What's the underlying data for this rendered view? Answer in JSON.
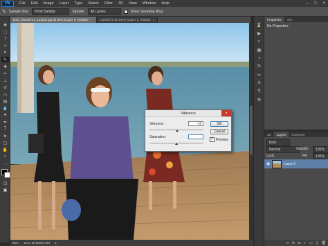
{
  "app": {
    "logo": "Ps"
  },
  "menu": [
    "File",
    "Edit",
    "Image",
    "Layer",
    "Type",
    "Select",
    "Filter",
    "3D",
    "View",
    "Window",
    "Help"
  ],
  "window_controls": [
    "–",
    "□",
    "×"
  ],
  "options_bar": {
    "sample_size_label": "Sample Size:",
    "sample_size_value": "Point Sample",
    "sample_label": "Sample:",
    "sample_value": "All Layers",
    "show_ring_label": "Show Sampling Ring"
  },
  "tabs": [
    {
      "label": "DSC_20120714_113631.jpg @ 50% (Layer 0, RGB/8) *",
      "active": true
    },
    {
      "label": "Untitled-1 @ 100% (Layer 1, RGB/8)",
      "active": false
    }
  ],
  "status": {
    "zoom": "50%",
    "doc": "Doc: 20.6M/20.6M"
  },
  "properties_panel": {
    "tabs": [
      "Properties",
      "Info"
    ],
    "title": "No Properties"
  },
  "layers_panel": {
    "tabs": [
      "3D",
      "Layers",
      "Channels"
    ],
    "filter_label": "Kind",
    "blend_mode": "Normal",
    "opacity_label": "Opacity:",
    "opacity_value": "100%",
    "lock_label": "Lock:",
    "fill_label": "Fill:",
    "fill_value": "100%",
    "layer_name": "Layer 0"
  },
  "dialog": {
    "title": "Vibrance",
    "vibrance_label": "Vibrance:",
    "vibrance_value": "+2",
    "saturation_label": "Saturation:",
    "saturation_value": "",
    "ok_label": "OK",
    "cancel_label": "Cancel",
    "preview_label": "Preview",
    "preview_checked": true,
    "vibrance_level": 0.51,
    "saturation_level": 0.5
  },
  "colors": {
    "chrome": "#535353",
    "panel": "#4a4a4a",
    "accent": "#3c7fb1",
    "selection": "#5d7fa8"
  }
}
